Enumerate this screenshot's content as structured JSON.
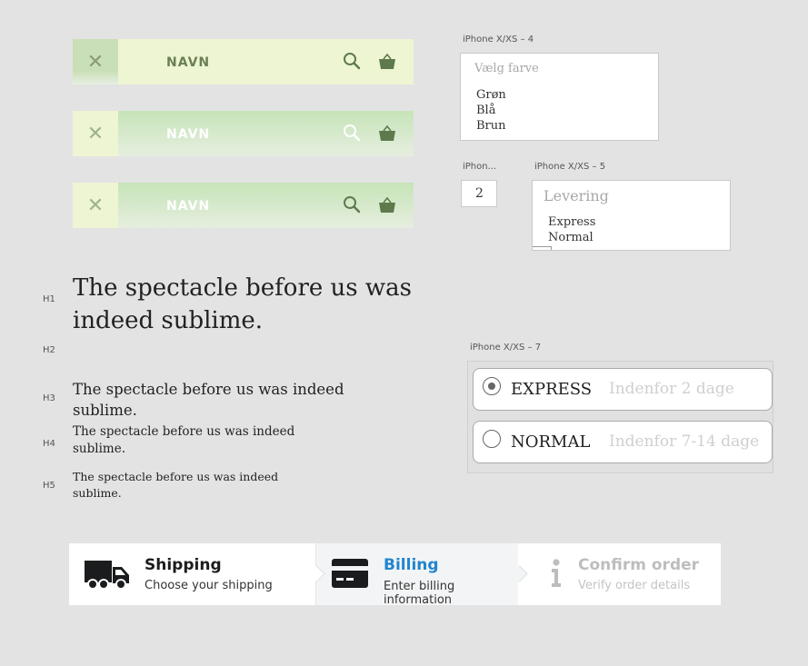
{
  "navbars": [
    {
      "title": "NAVN"
    },
    {
      "title": "NAVN"
    },
    {
      "title": "NAVN"
    }
  ],
  "frames": {
    "color_frame": {
      "label": "iPhone X/XS – 4",
      "placeholder": "Vælg farve",
      "options": [
        "Grøn",
        "Blå",
        "Brun"
      ]
    },
    "qty_frame": {
      "label": "iPhon...",
      "value": "2"
    },
    "delivery_frame": {
      "label": "iPhone X/XS – 5",
      "placeholder": "Levering",
      "options": [
        "Express",
        "Normal"
      ]
    },
    "radio_frame": {
      "label": "iPhone X/XS – 7",
      "options": [
        {
          "name": "EXPRESS",
          "desc": "Indenfor 2 dage",
          "selected": true
        },
        {
          "name": "NORMAL",
          "desc": "Indenfor 7-14 dage",
          "selected": false
        }
      ]
    }
  },
  "typography": {
    "h1": {
      "tag": "H1",
      "text": "The spectacle before us was indeed sublime."
    },
    "h2": {
      "tag": "H2"
    },
    "h3": {
      "tag": "H3",
      "text": "The spectacle before us was indeed sublime."
    },
    "h4": {
      "tag": "H4",
      "text": "The spectacle before us was indeed sublime."
    },
    "h5": {
      "tag": "H5",
      "text": "The spectacle before us was indeed sublime."
    }
  },
  "stepper": {
    "steps": [
      {
        "title": "Shipping",
        "subtitle": "Choose your shipping",
        "icon": "truck-icon",
        "state": "done"
      },
      {
        "title": "Billing",
        "subtitle": "Enter billing information",
        "icon": "credit-card-icon",
        "state": "active"
      },
      {
        "title": "Confirm order",
        "subtitle": "Verify order details",
        "icon": "info-icon",
        "state": "disabled"
      }
    ]
  },
  "colors": {
    "accent_blue": "#2185d0",
    "nav_green": "#6b8a5a",
    "nav_light": "#eef5d2"
  }
}
